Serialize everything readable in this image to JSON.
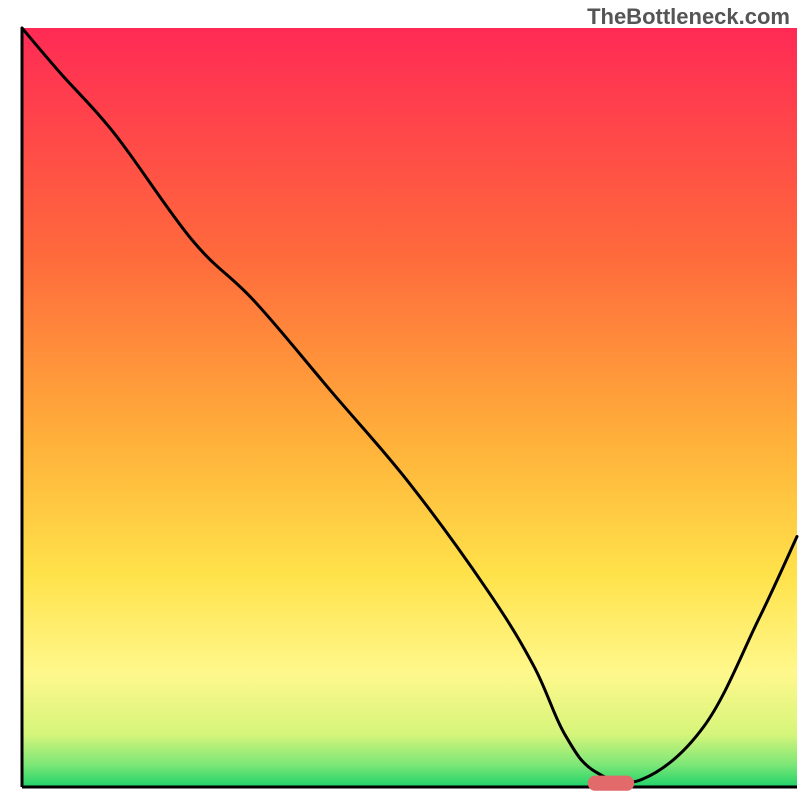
{
  "watermark": "TheBottleneck.com",
  "chart_data": {
    "type": "line",
    "title": "",
    "xlabel": "",
    "ylabel": "",
    "xlim": [
      0,
      100
    ],
    "ylim": [
      0,
      100
    ],
    "background": {
      "type": "vertical-gradient",
      "stops": [
        {
          "offset": 0.0,
          "color": "#ff2a55"
        },
        {
          "offset": 0.3,
          "color": "#ff6a3c"
        },
        {
          "offset": 0.55,
          "color": "#ffb23a"
        },
        {
          "offset": 0.72,
          "color": "#ffe24a"
        },
        {
          "offset": 0.85,
          "color": "#fff88c"
        },
        {
          "offset": 0.93,
          "color": "#d6f57a"
        },
        {
          "offset": 0.97,
          "color": "#7ee777"
        },
        {
          "offset": 1.0,
          "color": "#1fd36a"
        }
      ]
    },
    "series": [
      {
        "name": "bottleneck-curve",
        "color": "#000000",
        "x": [
          0,
          5,
          12,
          22,
          30,
          40,
          50,
          60,
          66,
          70,
          74,
          80,
          88,
          95,
          100
        ],
        "y": [
          100,
          94,
          86,
          72,
          64,
          52,
          40,
          26,
          16,
          7,
          2,
          1,
          8,
          22,
          33
        ]
      }
    ],
    "marker": {
      "name": "optimal-range",
      "shape": "rounded-bar",
      "color": "#e36a6a",
      "x_start": 73,
      "x_end": 79,
      "y": 0.5,
      "height": 2
    },
    "axes": {
      "left": {
        "visible": true,
        "color": "#000000",
        "width": 3
      },
      "bottom": {
        "visible": true,
        "color": "#000000",
        "width": 3
      },
      "right": {
        "visible": false
      },
      "top": {
        "visible": false
      }
    }
  }
}
